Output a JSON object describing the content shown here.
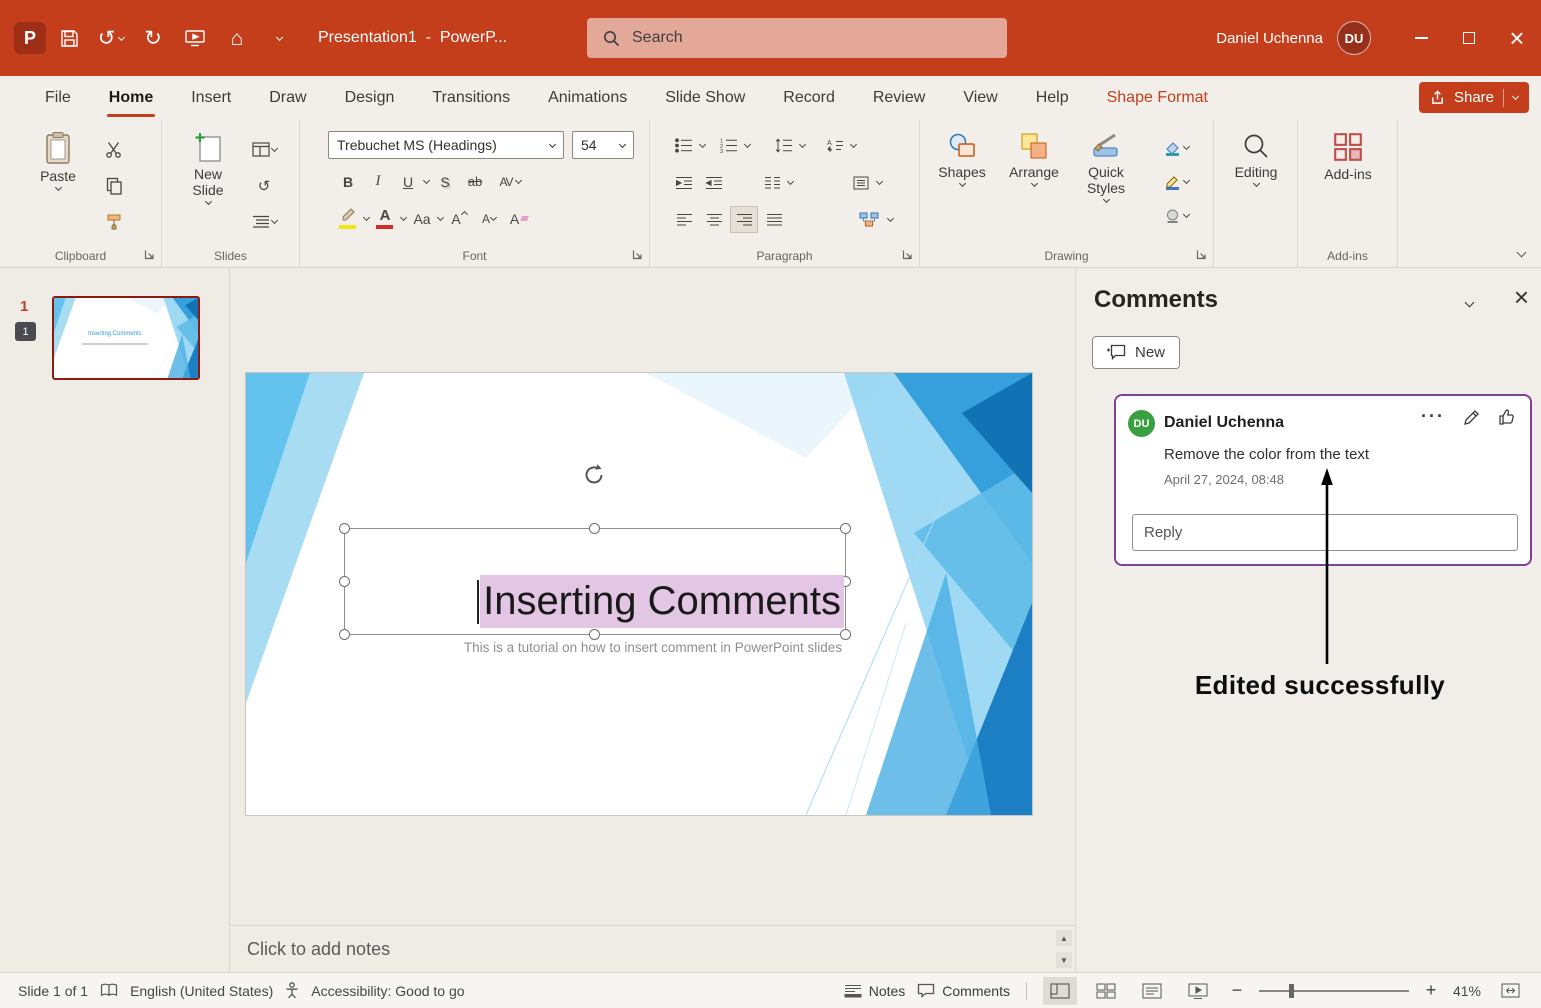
{
  "titlebar": {
    "doc_title": "Presentation1  -  PowerP...",
    "search_placeholder": "Search",
    "user_name": "Daniel Uchenna",
    "user_initials": "DU"
  },
  "menu": {
    "tabs": [
      "File",
      "Home",
      "Insert",
      "Draw",
      "Design",
      "Transitions",
      "Animations",
      "Slide Show",
      "Record",
      "Review",
      "View",
      "Help",
      "Shape Format"
    ],
    "share_label": "Share"
  },
  "ribbon": {
    "paste_label": "Paste",
    "new_slide_label": "New Slide",
    "font_name": "Trebuchet MS (Headings)",
    "font_size": "54",
    "bold": "B",
    "italic": "I",
    "underline": "U",
    "text_shadow": "S",
    "strikethrough": "ab",
    "character_spacing": "AV",
    "change_case": "Aa",
    "grow_font": "A",
    "shrink_font": "A",
    "clear_formatting": "A",
    "shapes_label": "Shapes",
    "arrange_label": "Arrange",
    "quick_styles_label": "Quick Styles",
    "editing_label": "Editing",
    "addins_label": "Add-ins",
    "groups": {
      "clipboard": "Clipboard",
      "slides": "Slides",
      "font": "Font",
      "paragraph": "Paragraph",
      "drawing": "Drawing",
      "addins": "Add-ins"
    }
  },
  "thumbnails": {
    "slide_number": "1",
    "comment_badge": "1"
  },
  "slide": {
    "title": "Inserting Comments",
    "subtitle": "This is a tutorial on how to insert comment in PowerPoint slides"
  },
  "comments_panel": {
    "header": "Comments",
    "new_button": "New",
    "comment": {
      "author": "Daniel Uchenna",
      "initials": "DU",
      "body": "Remove the color from the text",
      "timestamp": "April 27, 2024, 08:48",
      "reply_placeholder": "Reply"
    },
    "annotation": "Edited successfully"
  },
  "notes": {
    "placeholder": "Click to add notes"
  },
  "statusbar": {
    "slide_info": "Slide 1 of 1",
    "language": "English (United States)",
    "accessibility": "Accessibility: Good to go",
    "notes_label": "Notes",
    "comments_label": "Comments",
    "zoom_level": "41%"
  },
  "colors": {
    "titlebar_red": "#C43E1C",
    "accent_red": "#C43E1C",
    "comment_border": "#7E3F9D",
    "text_highlight": "#E3C6E4",
    "avatar_green": "#3AA03F",
    "slide_accent_blue": "#2E9BD6"
  }
}
